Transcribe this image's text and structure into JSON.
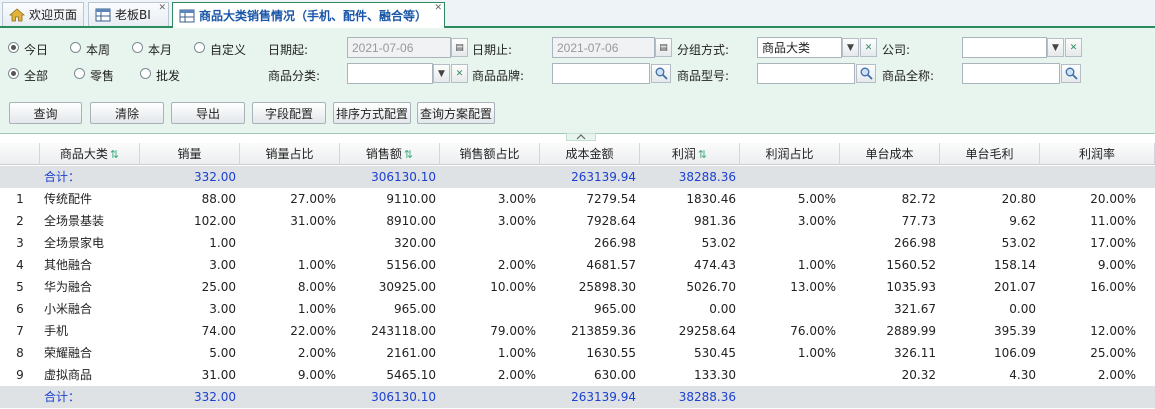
{
  "tabs": [
    {
      "label": "欢迎页面",
      "icon": "home-icon",
      "closable": false
    },
    {
      "label": "老板BI",
      "icon": "table-icon",
      "closable": true
    },
    {
      "label": "商品大类销售情况（手机、配件、融合等）",
      "icon": "table-icon",
      "closable": true,
      "active": true
    }
  ],
  "filters": {
    "period": {
      "options": [
        "今日",
        "本周",
        "本月",
        "自定义"
      ],
      "selected": "今日"
    },
    "sale_type": {
      "options": [
        "全部",
        "零售",
        "批发"
      ],
      "selected": "全部"
    },
    "date_from_label": "日期起:",
    "date_from": "2021-07-06",
    "date_to_label": "日期止:",
    "date_to": "2021-07-06",
    "group_label": "分组方式:",
    "group_value": "商品大类",
    "company_label": "公司:",
    "company_value": "",
    "category_label": "商品分类:",
    "category_value": "",
    "brand_label": "商品品牌:",
    "brand_value": "",
    "model_label": "商品型号:",
    "model_value": "",
    "fullname_label": "商品全称:",
    "fullname_value": ""
  },
  "buttons": {
    "query": "查询",
    "clear": "清除",
    "export": "导出",
    "field_config": "字段配置",
    "sort_config": "排序方式配置",
    "query_plan": "查询方案配置"
  },
  "columns": [
    "商品大类",
    "销量",
    "销量占比",
    "销售额",
    "销售额占比",
    "成本金额",
    "利润",
    "利润占比",
    "单台成本",
    "单台毛利",
    "利润率"
  ],
  "sortable_columns": [
    "商品大类",
    "销售额",
    "利润"
  ],
  "summary": {
    "label": "合计：",
    "qty": "332.00",
    "sales": "306130.10",
    "cost": "263139.94",
    "profit": "38288.36"
  },
  "rows": [
    {
      "n": "1",
      "name": "传统配件",
      "qty": "88.00",
      "qty_pct": "27.00%",
      "sales": "9110.00",
      "sales_pct": "3.00%",
      "cost": "7279.54",
      "profit": "1830.46",
      "profit_pct": "5.00%",
      "unit_cost": "82.72",
      "unit_margin": "20.80",
      "margin_rate": "20.00%"
    },
    {
      "n": "2",
      "name": "全场景基装",
      "qty": "102.00",
      "qty_pct": "31.00%",
      "sales": "8910.00",
      "sales_pct": "3.00%",
      "cost": "7928.64",
      "profit": "981.36",
      "profit_pct": "3.00%",
      "unit_cost": "77.73",
      "unit_margin": "9.62",
      "margin_rate": "11.00%"
    },
    {
      "n": "3",
      "name": "全场景家电",
      "qty": "1.00",
      "qty_pct": "",
      "sales": "320.00",
      "sales_pct": "",
      "cost": "266.98",
      "profit": "53.02",
      "profit_pct": "",
      "unit_cost": "266.98",
      "unit_margin": "53.02",
      "margin_rate": "17.00%"
    },
    {
      "n": "4",
      "name": "其他融合",
      "qty": "3.00",
      "qty_pct": "1.00%",
      "sales": "5156.00",
      "sales_pct": "2.00%",
      "cost": "4681.57",
      "profit": "474.43",
      "profit_pct": "1.00%",
      "unit_cost": "1560.52",
      "unit_margin": "158.14",
      "margin_rate": "9.00%"
    },
    {
      "n": "5",
      "name": "华为融合",
      "qty": "25.00",
      "qty_pct": "8.00%",
      "sales": "30925.00",
      "sales_pct": "10.00%",
      "cost": "25898.30",
      "profit": "5026.70",
      "profit_pct": "13.00%",
      "unit_cost": "1035.93",
      "unit_margin": "201.07",
      "margin_rate": "16.00%"
    },
    {
      "n": "6",
      "name": "小米融合",
      "qty": "3.00",
      "qty_pct": "1.00%",
      "sales": "965.00",
      "sales_pct": "",
      "cost": "965.00",
      "profit": "0.00",
      "profit_pct": "",
      "unit_cost": "321.67",
      "unit_margin": "0.00",
      "margin_rate": ""
    },
    {
      "n": "7",
      "name": "手机",
      "qty": "74.00",
      "qty_pct": "22.00%",
      "sales": "243118.00",
      "sales_pct": "79.00%",
      "cost": "213859.36",
      "profit": "29258.64",
      "profit_pct": "76.00%",
      "unit_cost": "2889.99",
      "unit_margin": "395.39",
      "margin_rate": "12.00%"
    },
    {
      "n": "8",
      "name": "荣耀融合",
      "qty": "5.00",
      "qty_pct": "2.00%",
      "sales": "2161.00",
      "sales_pct": "1.00%",
      "cost": "1630.55",
      "profit": "530.45",
      "profit_pct": "1.00%",
      "unit_cost": "326.11",
      "unit_margin": "106.09",
      "margin_rate": "25.00%"
    },
    {
      "n": "9",
      "name": "虚拟商品",
      "qty": "31.00",
      "qty_pct": "9.00%",
      "sales": "5465.10",
      "sales_pct": "2.00%",
      "cost": "630.00",
      "profit": "133.30",
      "profit_pct": "",
      "unit_cost": "20.32",
      "unit_margin": "4.30",
      "margin_rate": "2.00%"
    }
  ]
}
